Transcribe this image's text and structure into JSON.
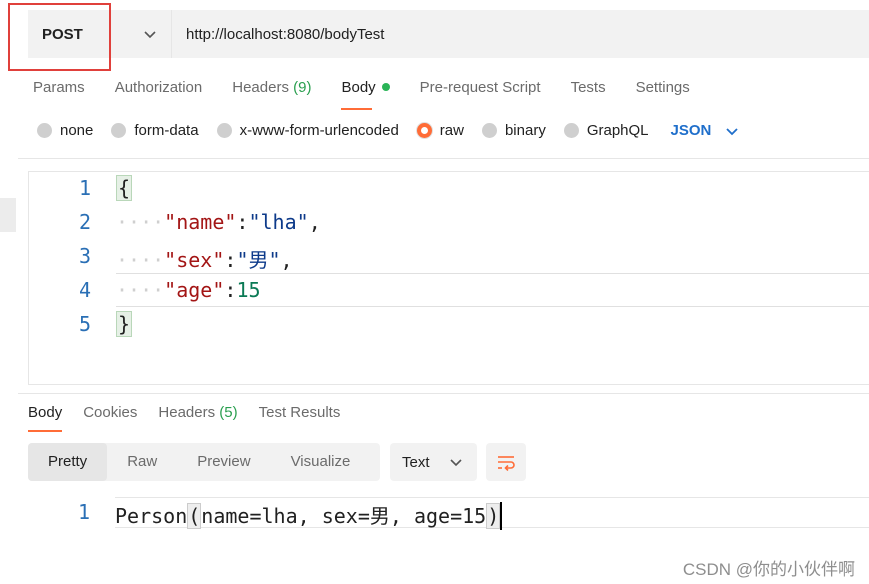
{
  "request": {
    "method": "POST",
    "url": "http://localhost:8080/bodyTest"
  },
  "request_tabs": [
    {
      "label": "Params"
    },
    {
      "label": "Authorization"
    },
    {
      "label": "Headers",
      "count": "(9)"
    },
    {
      "label": "Body"
    },
    {
      "label": "Pre-request Script"
    },
    {
      "label": "Tests"
    },
    {
      "label": "Settings"
    }
  ],
  "body_types": {
    "options": [
      "none",
      "form-data",
      "x-www-form-urlencoded",
      "raw",
      "binary",
      "GraphQL"
    ],
    "selected": "raw",
    "format": "JSON"
  },
  "editor": {
    "line_numbers": [
      "1",
      "2",
      "3",
      "4",
      "5"
    ],
    "open_brace": "{",
    "close_brace": "}",
    "indent": "····",
    "fields": [
      {
        "key": "\"name\"",
        "sep": ":",
        "value": "\"lha\"",
        "trail": ","
      },
      {
        "key": "\"sex\"",
        "sep": ":",
        "value": "\"男\"",
        "trail": ","
      },
      {
        "key": "\"age\"",
        "sep": ":",
        "value": "15",
        "trail": ""
      }
    ]
  },
  "response_tabs": [
    {
      "label": "Body"
    },
    {
      "label": "Cookies"
    },
    {
      "label": "Headers",
      "count": "(5)"
    },
    {
      "label": "Test Results"
    }
  ],
  "response_view": {
    "modes": [
      "Pretty",
      "Raw",
      "Preview",
      "Visualize"
    ],
    "format": "Text"
  },
  "response_body": {
    "line_number": "1",
    "prefix": "Person",
    "open_paren": "(",
    "content": "name=lha, sex=男, age=15",
    "close_paren": ")"
  },
  "watermark": "CSDN @你的小伙伴啊",
  "colors": {
    "accent": "#ff6c37",
    "highlight_box": "#e0403b",
    "json_blue": "#1f6fcb",
    "status_green": "#2ab457"
  }
}
